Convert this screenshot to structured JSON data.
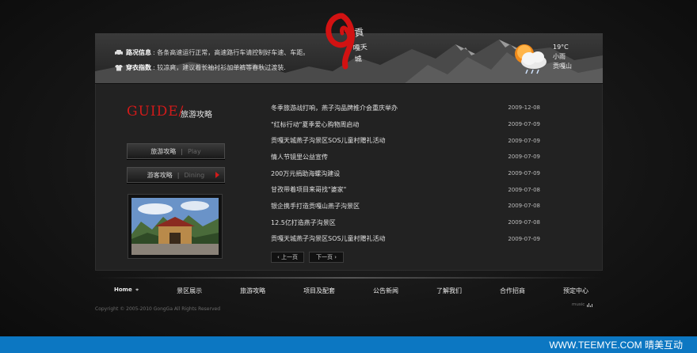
{
  "header": {
    "traffic_label": "路况信息",
    "traffic_text": ": 各条高速运行正常，高速路行车请控制好车速、车距。",
    "clothing_label": "穿衣指数",
    "clothing_text": ": 较凉爽，建议着长袖衬衫加单裤等春秋过渡装.",
    "weather_temp": "19°C",
    "weather_desc": "小雨",
    "weather_place": "贡嘎山"
  },
  "guide": {
    "title": "GUIDE/",
    "subtitle": "旅游攻略"
  },
  "sidebar_buttons": [
    {
      "cn": "旅游攻略",
      "en": "Play"
    },
    {
      "cn": "游客攻略",
      "en": "Dining"
    }
  ],
  "news": [
    {
      "title": "冬季旅游战打响，燕子沟品牌推介会重庆举办",
      "date": "2009-12-08"
    },
    {
      "title": "\"红标行动\"夏季爱心购物周启动",
      "date": "2009-07-09"
    },
    {
      "title": "贡嘎天城燕子沟景区SOS儿童村赠礼活动",
      "date": "2009-07-09"
    },
    {
      "title": "情人节镜里公益宣传",
      "date": "2009-07-09"
    },
    {
      "title": "200万元捐助海螺沟建设",
      "date": "2009-07-09"
    },
    {
      "title": "甘孜带着项目来哥找\"婆家\"",
      "date": "2009-07-08"
    },
    {
      "title": "银企携手打造贡嘎山燕子沟景区",
      "date": "2009-07-08"
    },
    {
      "title": "12.5亿打造燕子沟景区",
      "date": "2009-07-08"
    },
    {
      "title": "贡嘎天城燕子沟景区SOS儿童村赠礼活动",
      "date": "2009-07-09"
    }
  ],
  "pager": {
    "prev": "‹ 上一页",
    "next": "下一页 ›"
  },
  "nav": {
    "home": "Home",
    "items": [
      "景区展示",
      "旅游攻略",
      "项目及配套",
      "公告新闻",
      "了解我们",
      "合作招商",
      "预定中心"
    ]
  },
  "copyright": "Copyright © 2005-2010 GongGa All Rights Reserved",
  "music_label": "music",
  "watermark": "WWW.TEEMYE.COM  晴美互动",
  "colors": {
    "accent": "#d11a1a",
    "bar": "#0c77c2"
  }
}
